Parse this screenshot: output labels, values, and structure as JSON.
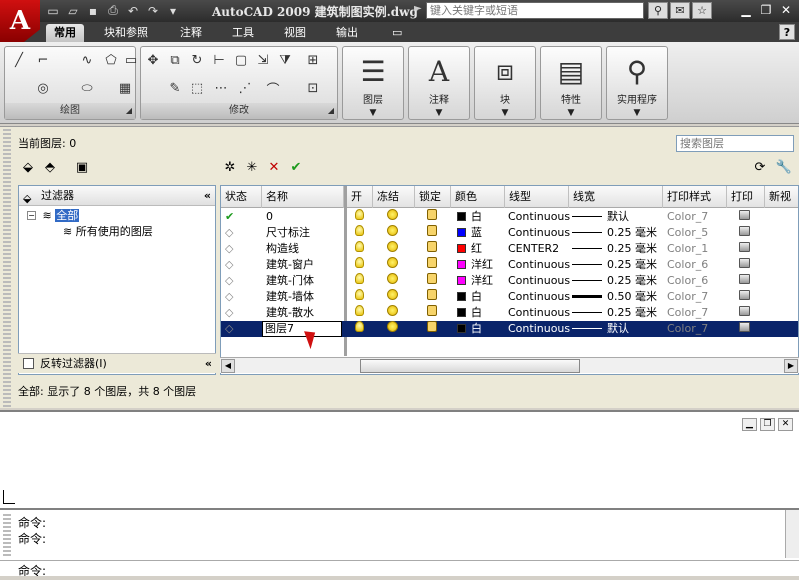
{
  "titlebar": {
    "app_letter": "A",
    "title": "AutoCAD 2009  建筑制图实例.dwg",
    "search_placeholder": "键入关键字或短语"
  },
  "ribbon": {
    "tabs": [
      "常用",
      "块和参照",
      "注释",
      "工具",
      "视图",
      "输出"
    ],
    "panels": {
      "draw_label": "绘图",
      "modify_label": "修改"
    },
    "big_buttons": [
      {
        "label": "图层"
      },
      {
        "label": "注释"
      },
      {
        "label": "块"
      },
      {
        "label": "特性"
      },
      {
        "label": "实用程序"
      }
    ]
  },
  "layer_manager": {
    "current_layer": "当前图层: 0",
    "search_placeholder": "搜索图层",
    "tree": {
      "header": "过滤器",
      "nodes": [
        "全部",
        "所有使用的图层"
      ],
      "invert_label": "反转过滤器(I)"
    },
    "columns": [
      "状态",
      "名称",
      "开",
      "冻结",
      "锁定",
      "颜色",
      "线型",
      "线宽",
      "打印样式",
      "打印",
      "新视"
    ],
    "rows": [
      {
        "status": "✔",
        "name": "0",
        "color_name": "白",
        "color_hex": "#000000",
        "linetype": "Continuous",
        "lineweight": "默认",
        "plot_style": "Color_7"
      },
      {
        "status": "",
        "name": "尺寸标注",
        "color_name": "蓝",
        "color_hex": "#0000ff",
        "linetype": "Continuous",
        "lineweight": "0.25 毫米",
        "plot_style": "Color_5"
      },
      {
        "status": "",
        "name": "构造线",
        "color_name": "红",
        "color_hex": "#ff0000",
        "linetype": "CENTER2",
        "lineweight": "0.25 毫米",
        "plot_style": "Color_1"
      },
      {
        "status": "",
        "name": "建筑-窗户",
        "color_name": "洋红",
        "color_hex": "#ff00ff",
        "linetype": "Continuous",
        "lineweight": "0.25 毫米",
        "plot_style": "Color_6"
      },
      {
        "status": "",
        "name": "建筑-门体",
        "color_name": "洋红",
        "color_hex": "#ff00ff",
        "linetype": "Continuous",
        "lineweight": "0.25 毫米",
        "plot_style": "Color_6"
      },
      {
        "status": "",
        "name": "建筑-墙体",
        "color_name": "白",
        "color_hex": "#000000",
        "linetype": "Continuous",
        "lineweight": "0.50 毫米",
        "plot_style": "Color_7"
      },
      {
        "status": "",
        "name": "建筑-散水",
        "color_name": "白",
        "color_hex": "#000000",
        "linetype": "Continuous",
        "lineweight": "0.25 毫米",
        "plot_style": "Color_7"
      },
      {
        "status": "",
        "name": "图层7",
        "color_name": "白",
        "color_hex": "#000000",
        "linetype": "Continuous",
        "lineweight": "默认",
        "plot_style": "Color_7"
      }
    ],
    "summary": "全部: 显示了 8 个图层，共 8 个图层"
  },
  "command": {
    "lines": [
      "命令:",
      "命令:"
    ],
    "prompt": "命令:"
  }
}
